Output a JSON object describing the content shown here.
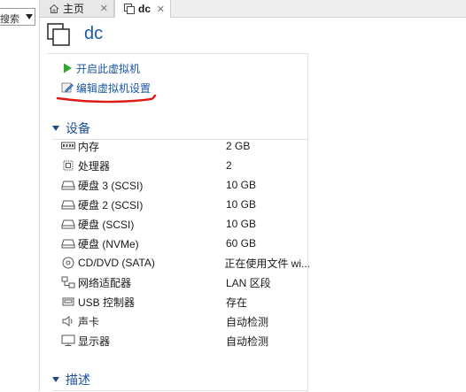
{
  "sidebar": {
    "search_text": "搜索"
  },
  "tabs": [
    {
      "label": "主页",
      "icon": "home-icon",
      "close": "✕"
    },
    {
      "label": "dc",
      "icon": "vm-icon",
      "close": "✕"
    }
  ],
  "vm": {
    "title": "dc"
  },
  "actions": [
    {
      "label": "开启此虚拟机",
      "icon": "play-icon"
    },
    {
      "label": "编辑虚拟机设置",
      "icon": "edit-settings-icon"
    }
  ],
  "sections": {
    "devices": "设备",
    "description": "描述"
  },
  "devices": [
    {
      "name": "内存",
      "value": "2 GB",
      "icon": "memory-icon"
    },
    {
      "name": "处理器",
      "value": "2",
      "icon": "cpu-icon"
    },
    {
      "name": "硬盘 3 (SCSI)",
      "value": "10 GB",
      "icon": "hard-disk-icon"
    },
    {
      "name": "硬盘 2 (SCSI)",
      "value": "10 GB",
      "icon": "hard-disk-icon"
    },
    {
      "name": "硬盘 (SCSI)",
      "value": "10 GB",
      "icon": "hard-disk-icon"
    },
    {
      "name": "硬盘 (NVMe)",
      "value": "60 GB",
      "icon": "hard-disk-icon"
    },
    {
      "name": "CD/DVD (SATA)",
      "value": "正在使用文件 wi...",
      "icon": "cd-dvd-icon"
    },
    {
      "name": "网络适配器",
      "value": "LAN 区段",
      "icon": "network-adapter-icon"
    },
    {
      "name": "USB 控制器",
      "value": "存在",
      "icon": "usb-icon"
    },
    {
      "name": "声卡",
      "value": "自动检测",
      "icon": "sound-card-icon"
    },
    {
      "name": "显示器",
      "value": "自动检测",
      "icon": "monitor-icon"
    }
  ],
  "colors": {
    "link": "#1a56a6",
    "title": "#1c5aa8",
    "annotation": "#e01818",
    "play": "#2ea82e"
  }
}
